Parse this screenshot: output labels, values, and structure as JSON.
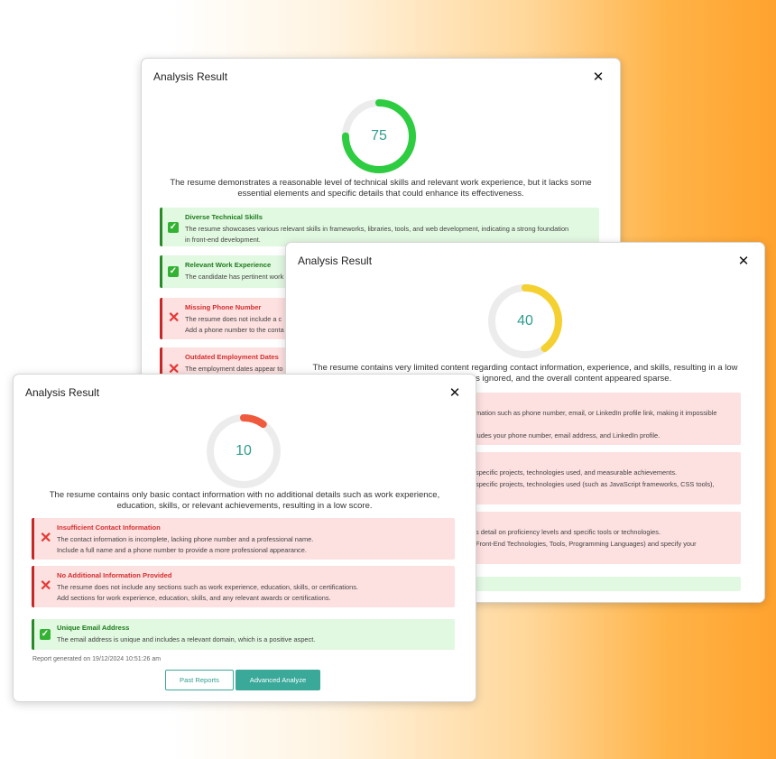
{
  "colors": {
    "teal": "#3aa99a",
    "green": "#2ecc40",
    "yellow": "#f5d031",
    "red": "#f05a3c",
    "bg_orange": "#ffa22e"
  },
  "back_card": {
    "title": "Analysis Result",
    "score": "75",
    "score_fraction": 0.75,
    "summary": "The resume demonstrates a reasonable level of technical skills and relevant work experience, but it lacks some essential elements and specific details that could enhance its effectiveness.",
    "items": [
      {
        "type": "good",
        "title": "Diverse Technical Skills",
        "lines": [
          "The resume showcases various relevant skills in frameworks, libraries, tools, and web development, indicating a strong foundation",
          "in front-end development."
        ]
      },
      {
        "type": "good",
        "title": "Relevant Work Experience",
        "lines": [
          "The candidate has pertinent work"
        ]
      },
      {
        "type": "bad",
        "title": "Missing Phone Number",
        "lines": [
          "The resume does not include a c",
          "Add a phone number to the conta"
        ]
      },
      {
        "type": "bad",
        "title": "Outdated Employment Dates",
        "lines": [
          "The employment dates appear to"
        ]
      }
    ]
  },
  "middle_card": {
    "title": "Analysis Result",
    "score": "40",
    "score_fraction": 0.4,
    "summary_line1": "The resume contains very limited content regarding contact information, experience, and skills, resulting in a low",
    "summary_line2": "was ignored, and the overall content appeared sparse.",
    "items": [
      {
        "type": "bad",
        "lines": [
          "mation such as phone number, email, or LinkedIn profile link, making it impossible",
          "",
          "ludes your phone number, email address, and LinkedIn profile."
        ]
      },
      {
        "type": "bad",
        "lines": [
          "specific projects, technologies used, and measurable achievements.",
          "specific projects, technologies used (such as JavaScript frameworks, CSS tools),"
        ]
      },
      {
        "type": "bad",
        "lines": [
          "s detail on proficiency levels and specific tools or technologies.",
          "Front-End Technologies, Tools, Programming Languages) and specify your"
        ]
      },
      {
        "type": "good",
        "lines": []
      }
    ]
  },
  "front_card": {
    "title": "Analysis Result",
    "score": "10",
    "score_fraction": 0.1,
    "summary": "The resume contains only basic contact information with no additional details such as work experience, education, skills, or relevant achievements, resulting in a low score.",
    "items": [
      {
        "type": "bad",
        "title": "Insufficient Contact Information",
        "lines": [
          "The contact information is incomplete, lacking phone number and a professional name.",
          "Include a full name and a phone number to provide a more professional appearance."
        ]
      },
      {
        "type": "bad",
        "title": "No Additional Information Provided",
        "lines": [
          "The resume does not include any sections such as work experience, education, skills, or certifications.",
          "Add sections for work experience, education, skills, and any relevant awards or certifications."
        ]
      },
      {
        "type": "good",
        "title": "Unique Email Address",
        "lines": [
          "The email address is unique and includes a relevant domain, which is a positive aspect."
        ]
      }
    ],
    "report_note": "Report generated on 19/12/2024 10:51:26 am",
    "btn_past": "Past Reports",
    "btn_advanced": "Advanced Analyze"
  },
  "icons": {
    "close": "close-icon",
    "check": "check-icon",
    "cross": "cross-icon"
  }
}
